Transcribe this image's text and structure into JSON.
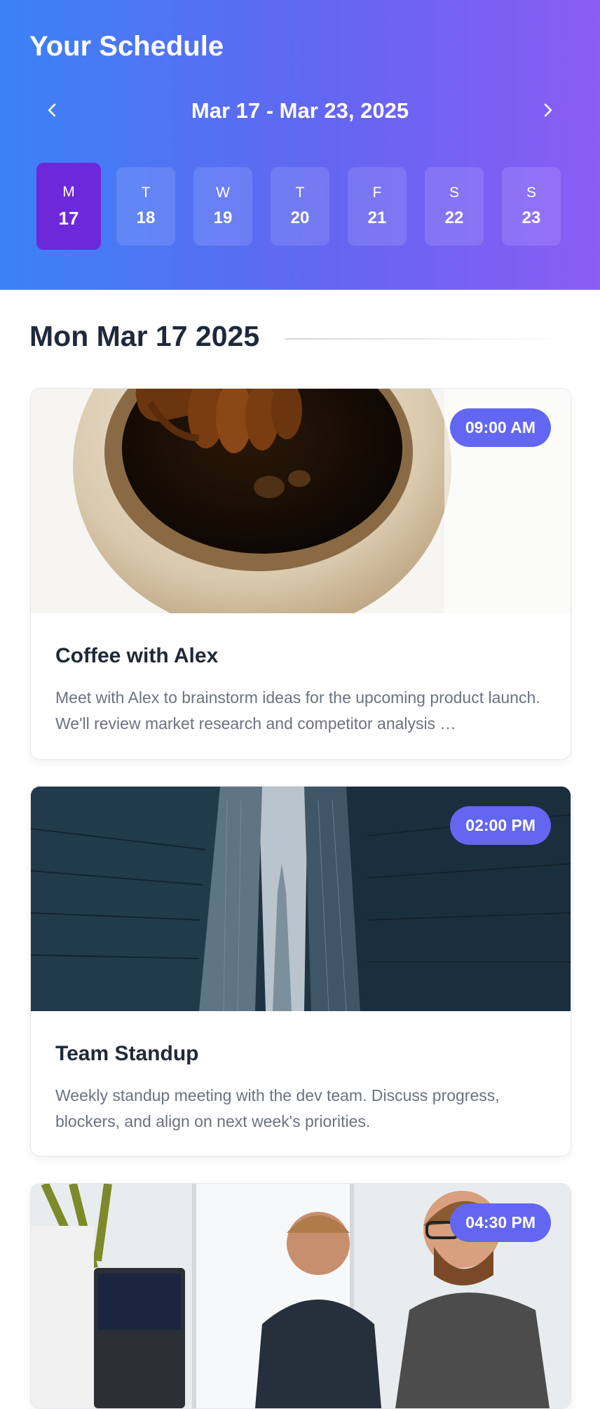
{
  "header": {
    "title": "Your Schedule",
    "week_range": "Mar 17 - Mar 23, 2025",
    "prev_icon": "chevron-left-icon",
    "next_icon": "chevron-right-icon"
  },
  "days": [
    {
      "weekday": "M",
      "date": "17",
      "selected": true
    },
    {
      "weekday": "T",
      "date": "18",
      "selected": false
    },
    {
      "weekday": "W",
      "date": "19",
      "selected": false
    },
    {
      "weekday": "T",
      "date": "20",
      "selected": false
    },
    {
      "weekday": "F",
      "date": "21",
      "selected": false
    },
    {
      "weekday": "S",
      "date": "22",
      "selected": false
    },
    {
      "weekday": "S",
      "date": "23",
      "selected": false
    }
  ],
  "selected_date_label": "Mon Mar 17 2025",
  "events": [
    {
      "time": "09:00 AM",
      "title": "Coffee with Alex",
      "description": "Meet with Alex to brainstorm ideas for the upcoming product launch. We'll review market research and competitor analysis …"
    },
    {
      "time": "02:00 PM",
      "title": "Team Standup",
      "description": "Weekly standup meeting with the dev team. Discuss progress, blockers, and align on next week's priorities."
    },
    {
      "time": "04:30 PM",
      "title": "",
      "description": ""
    }
  ],
  "colors": {
    "header_gradient_start": "#3b82f6",
    "header_gradient_end": "#8b5cf6",
    "selected_day": "#6d28d9",
    "badge": "#6366f1"
  }
}
